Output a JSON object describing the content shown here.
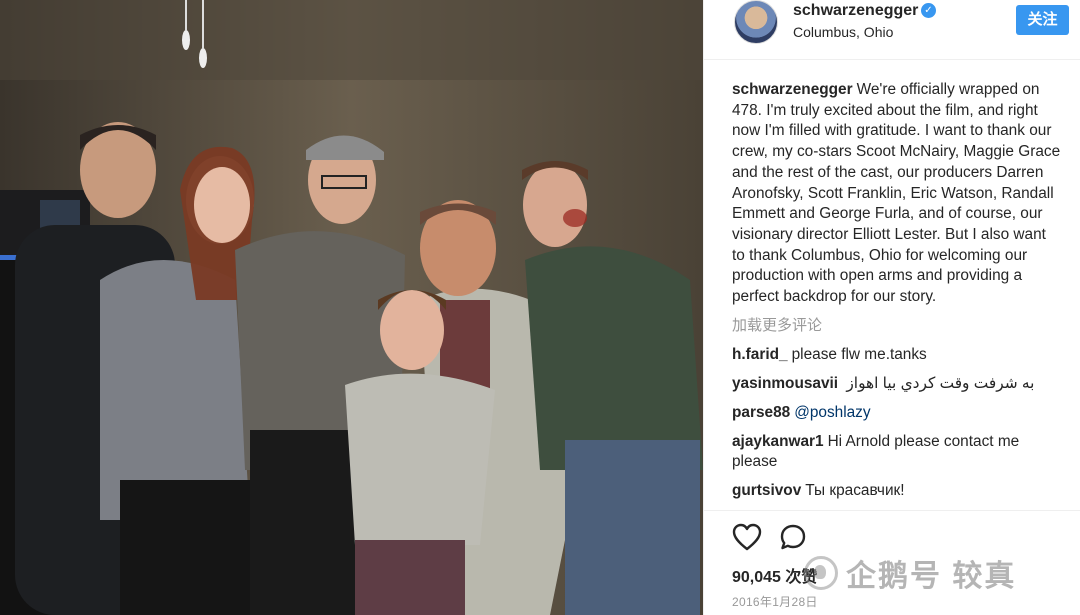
{
  "post": {
    "username": "schwarzenegger",
    "location": "Columbus, Ohio",
    "follow_label": "关注",
    "caption": "We're officially wrapped on 478. I'm truly excited about the film, and right now I'm filled with gratitude. I want to thank our crew, my co-stars Scoot McNairy, Maggie Grace and the rest of the cast, our producers Darren Aronofsky, Scott Franklin, Eric Watson, Randall Emmett and George Furla, and of course, our visionary director Elliott Lester. But I also want to thank Columbus, Ohio for welcoming our production with open arms and providing a perfect backdrop for our story.",
    "load_more": "加载更多评论",
    "comments": [
      {
        "user": "h.farid_",
        "text": "please flw me.tanks"
      },
      {
        "user": "yasinmousavii",
        "text": "به شرفت وقت کردي بيا اهواز"
      },
      {
        "user": "parse88",
        "mention": "@poshlazy"
      },
      {
        "user": "ajaykanwar1",
        "text": "Hi Arnold please contact me please"
      },
      {
        "user": "gurtsivov",
        "text": "Ты красавчик!"
      }
    ],
    "likes": "90,045 次赞",
    "date": "2016年1月28日"
  },
  "watermark": {
    "text": "企鹅号 较真"
  },
  "icons": {
    "heart": "heart-icon",
    "comment": "comment-icon",
    "verified": "verified-badge-icon"
  },
  "colors": {
    "accent": "#3897f0",
    "muted": "#999999",
    "mention": "#003569"
  }
}
